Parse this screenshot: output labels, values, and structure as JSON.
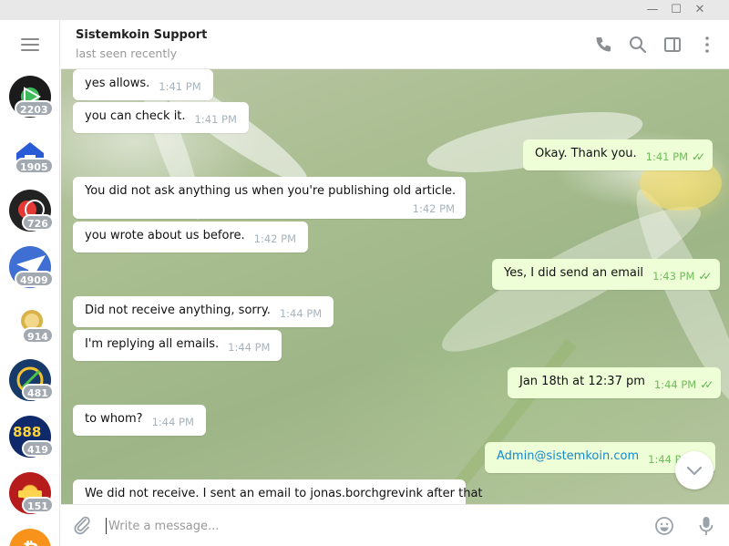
{
  "window": {
    "minimize_glyph": "—",
    "maximize_glyph": "☐",
    "close_glyph": "✕"
  },
  "sidebar": {
    "chats": [
      {
        "badge": "2203"
      },
      {
        "badge": "1905"
      },
      {
        "badge": "726"
      },
      {
        "badge": "4909"
      },
      {
        "badge": "914"
      },
      {
        "badge": "481"
      },
      {
        "badge": "419",
        "label": "888"
      },
      {
        "badge": "151"
      },
      {
        "badge": ""
      }
    ]
  },
  "header": {
    "title": "Sistemkoin Support",
    "status": "last seen recently"
  },
  "messages": [
    {
      "dir": "in",
      "text": "yes allows.",
      "time": "1:41 PM"
    },
    {
      "dir": "in",
      "text": "you can check it.",
      "time": "1:41 PM"
    },
    {
      "dir": "out",
      "text": "Okay. Thank you.",
      "time": "1:41 PM"
    },
    {
      "dir": "in",
      "text": "You did not ask anything us when you're publishing old article.",
      "time": "1:42 PM"
    },
    {
      "dir": "in",
      "text": "you wrote about us before.",
      "time": "1:42 PM"
    },
    {
      "dir": "out",
      "text": "Yes, I did send an email",
      "time": "1:43 PM"
    },
    {
      "dir": "in",
      "text": "Did not receive anything, sorry.",
      "time": "1:44 PM"
    },
    {
      "dir": "in",
      "text": "I'm replying all emails.",
      "time": "1:44 PM"
    },
    {
      "dir": "out",
      "text": "Jan 18th at 12:37 pm",
      "time": "1:44 PM"
    },
    {
      "dir": "in",
      "text": "to whom?",
      "time": "1:44 PM"
    },
    {
      "dir": "out",
      "text": "Admin@sistemkoin.com",
      "time": "1:44 PM"
    },
    {
      "dir": "in",
      "text": "We did not receive. I sent an email to jonas.borchgrevink after that",
      "time": ""
    }
  ],
  "compose": {
    "placeholder": "Write a message..."
  },
  "colors": {
    "accent": "#168acd",
    "outgoing_bubble": "#eefed6",
    "badge": "#a2a9b0",
    "tick": "#5cb24a"
  }
}
